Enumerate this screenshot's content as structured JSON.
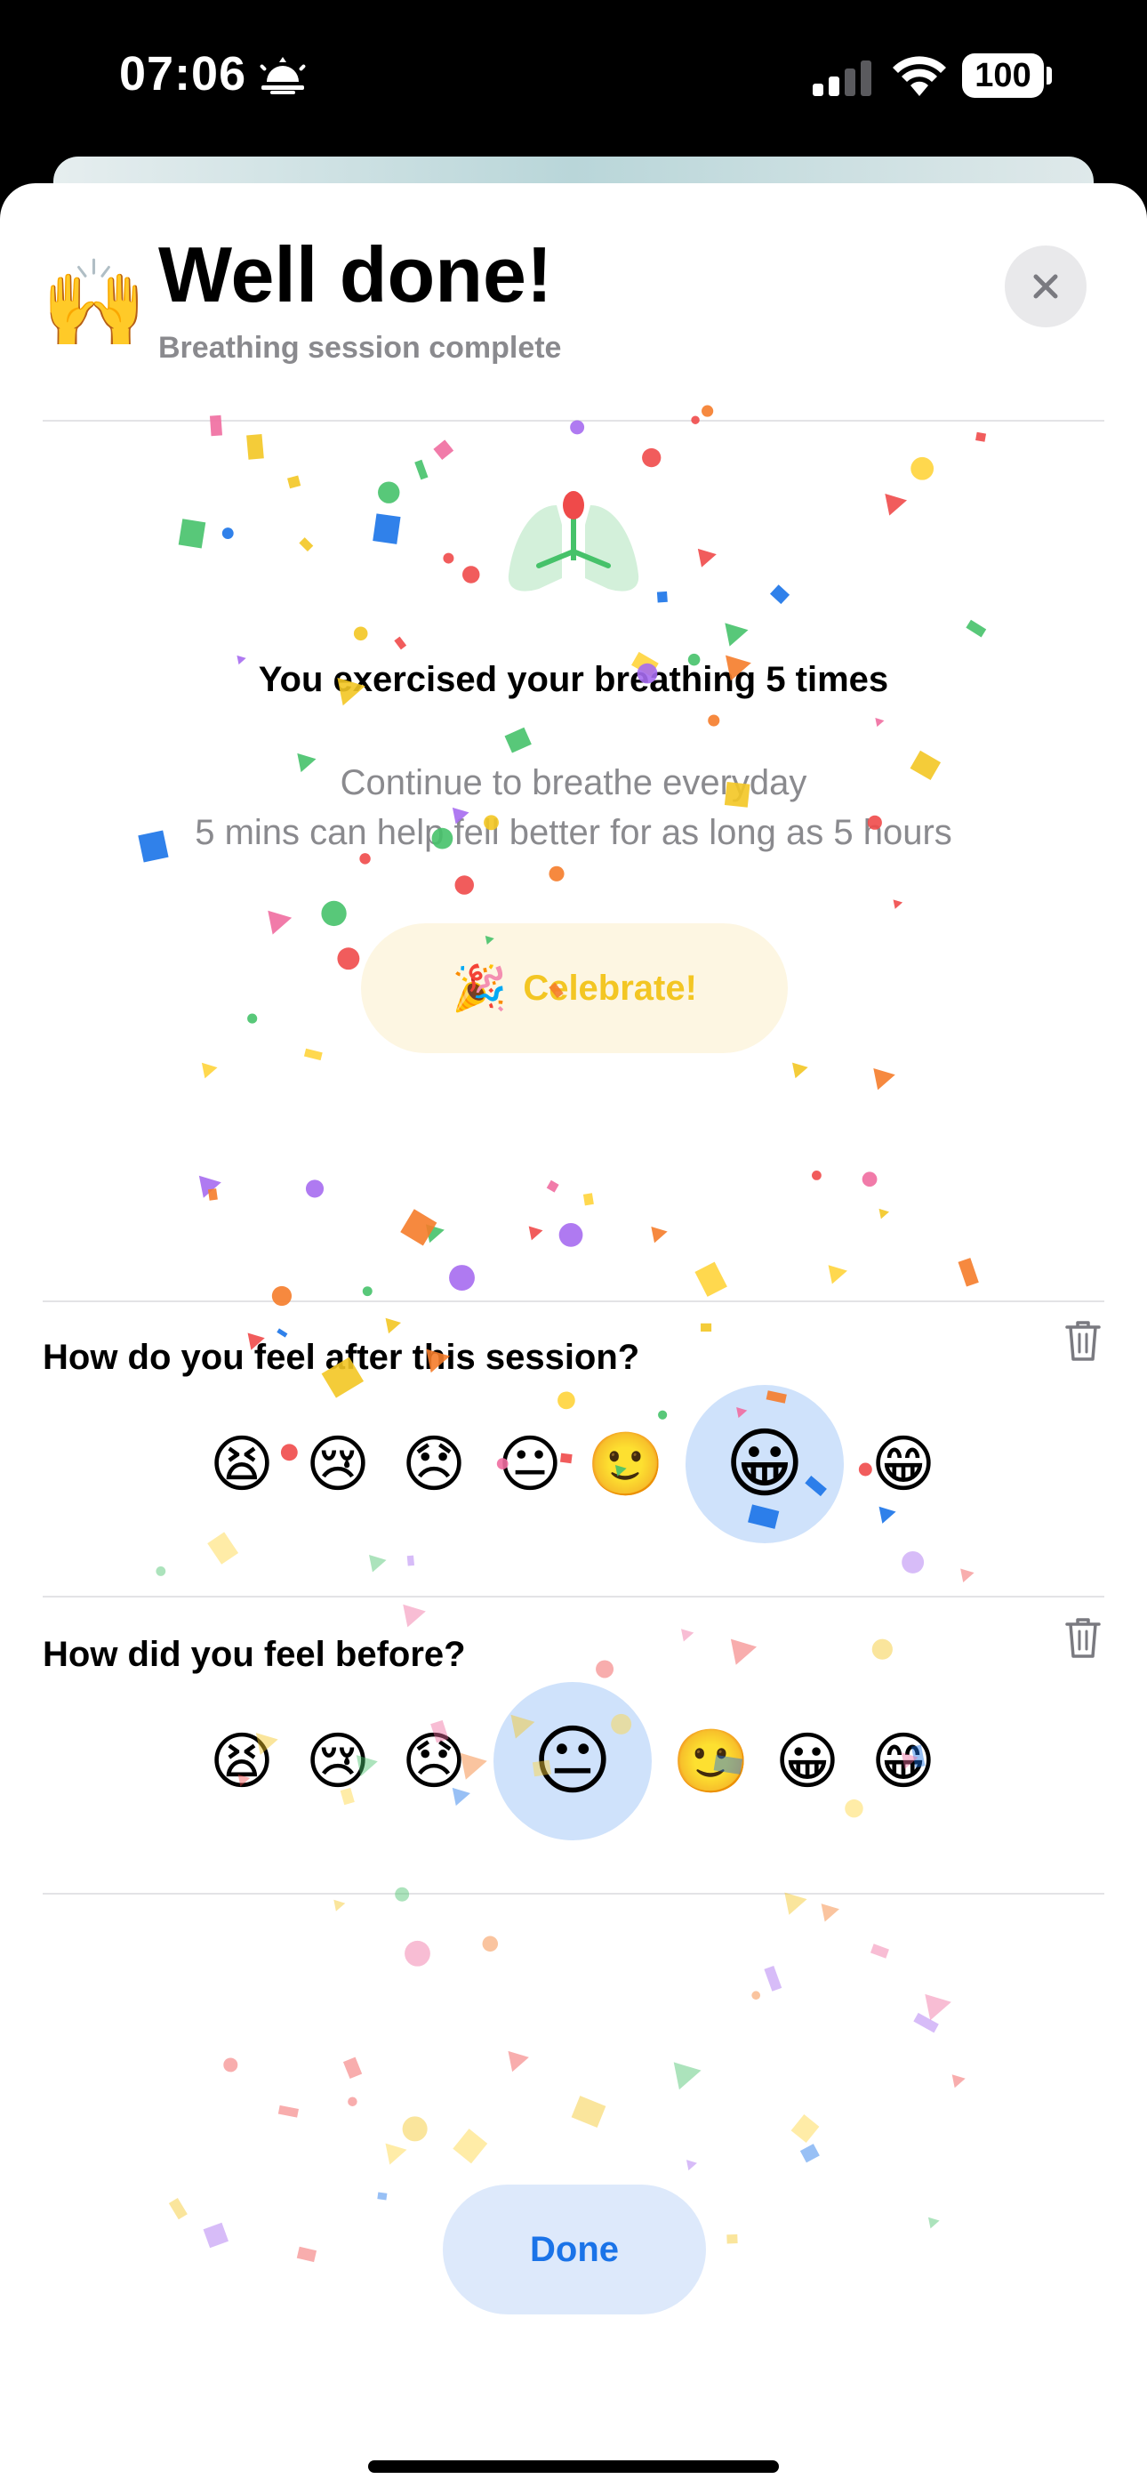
{
  "status": {
    "time": "07:06",
    "battery": "100"
  },
  "header": {
    "emoji": "🙌",
    "title": "Well done!",
    "subtitle": "Breathing session complete",
    "close_icon": "close-icon"
  },
  "summary": {
    "headline": "You exercised your breathing 5 times",
    "line1": "Continue to breathe everyday",
    "line2": "5 mins can help fell better for as long as 5 hours",
    "celebrate_emoji": "🎉",
    "celebrate_label": "Celebrate!"
  },
  "after": {
    "question": "How do you feel after this session?",
    "options": [
      "😫",
      "😢",
      "😞",
      "😐",
      "🙂",
      "😀",
      "😁"
    ],
    "selected_index": 5
  },
  "before": {
    "question": "How did you feel before?",
    "options": [
      "😫",
      "😢",
      "😞",
      "😐",
      "🙂",
      "😀",
      "😁"
    ],
    "selected_index": 3
  },
  "footer": {
    "done_label": "Done"
  },
  "colors": {
    "accent": "#1a73e8",
    "celebrate": "#f3c623",
    "selection": "#cfe2fb",
    "lungs": "#46c26a"
  }
}
